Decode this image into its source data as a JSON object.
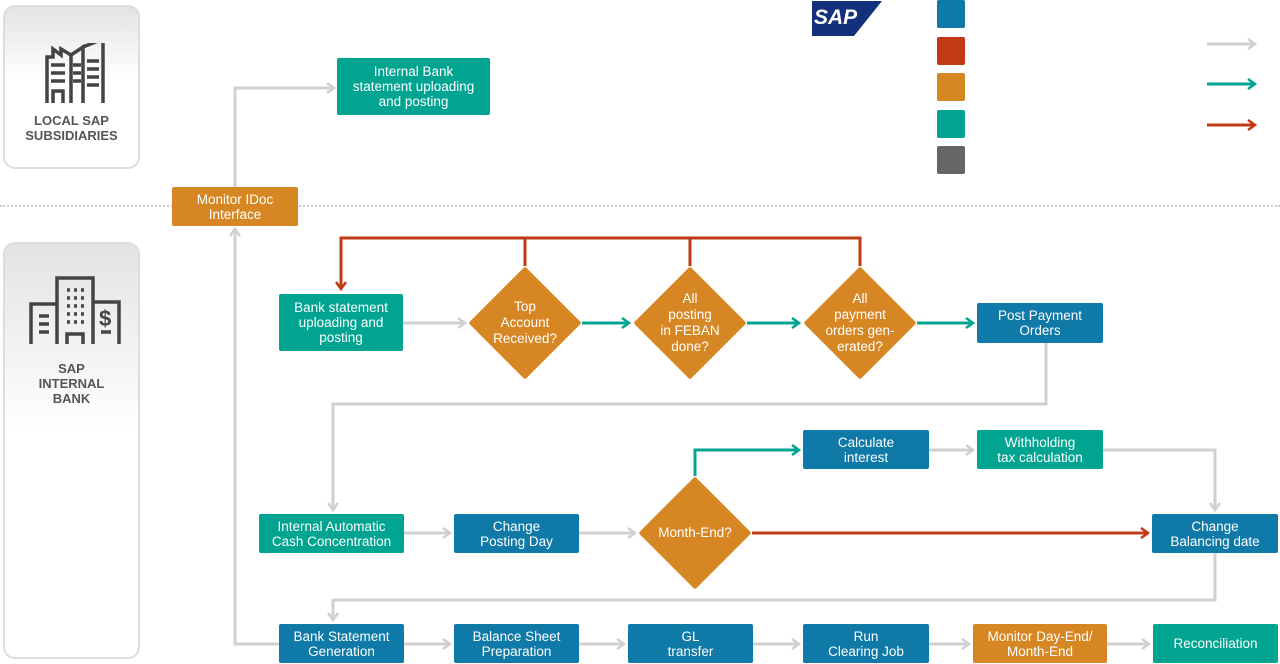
{
  "logo": {
    "text": "SAP"
  },
  "lanes": {
    "subsidiaries": {
      "label": "LOCAL SAP\nSUBSIDIARIES",
      "icon": "factory-icon"
    },
    "internal_bank": {
      "label": "SAP\nINTERNAL\nBANK",
      "icon": "bank-building-icon"
    }
  },
  "legend": {
    "swatches": [
      "#0f79a8",
      "#c23a15",
      "#d68724",
      "#00a491",
      "#666666"
    ],
    "arrows": [
      "#d0d0d0",
      "#00a491",
      "#c23a15"
    ]
  },
  "colors": {
    "blue": "#0f79a8",
    "red": "#c23a15",
    "orange": "#d68724",
    "teal": "#00a491",
    "gray": "#666666",
    "connector": "#d0d0d0"
  },
  "nodes": {
    "internal_bank_upload": "Internal Bank\nstatement uploading\nand posting",
    "monitor_idoc": "Monitor IDoc\nInterface",
    "bank_statement_upload": "Bank statement\nuploading and\nposting",
    "top_account": "Top\nAccount\nReceived?",
    "feban": "All\nposting\nin FEBAN\ndone?",
    "payment_orders": "All\npayment\norders gen-\nerated?",
    "post_payment": "Post Payment\nOrders",
    "calc_interest": "Calculate\ninterest",
    "withholding": "Withholding\ntax calculation",
    "cash_conc": "Internal Automatic\nCash Concentration",
    "change_posting": "Change\nPosting Day",
    "month_end": "Month-End?",
    "change_balancing": "Change\nBalancing date",
    "bank_stmt_gen": "Bank Statement\nGeneration",
    "balance_sheet": "Balance Sheet\nPreparation",
    "gl_transfer": "GL\ntransfer",
    "clearing_job": "Run\nClearing Job",
    "monitor_dayend": "Monitor Day-End/\nMonth-End",
    "reconciliation": "Reconciliation"
  }
}
